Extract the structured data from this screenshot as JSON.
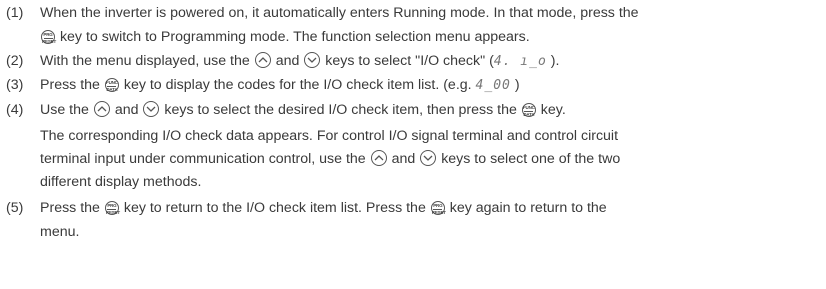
{
  "steps": [
    {
      "num": "(1)",
      "l1a": "When the inverter is powered on, it automatically enters Running mode. In that mode, press the",
      "l2a": "key to switch to Programming mode. The function selection menu appears."
    },
    {
      "num": "(2)",
      "a": "With the menu displayed, use the",
      "b": "and",
      "c": "keys to select \"I/O check\" (",
      "lcd": "4. ı_o",
      "d": ")."
    },
    {
      "num": "(3)",
      "a": "Press the",
      "b": "key to display the codes for the I/O check item list. (e.g.",
      "lcd": "4_00",
      "c": ")"
    },
    {
      "num": "(4)",
      "a": "Use the",
      "b": "and",
      "c": "keys to select the desired I/O check item, then press the",
      "d": "key.",
      "p1": "The corresponding I/O check data appears. For control I/O signal terminal and control circuit",
      "p2a": "terminal input under communication control, use the",
      "p2b": "and",
      "p2c": "keys to select one of the two",
      "p3": "different display methods."
    },
    {
      "num": "(5)",
      "a": "Press the",
      "b": "key to return to the I/O check item list. Press the",
      "c": "key again to return to the",
      "d": "menu."
    }
  ],
  "keys": {
    "prg_top": "PRG",
    "prg_bottom": "RESET",
    "func_top": "FUNC",
    "func_bottom": "DATA"
  }
}
